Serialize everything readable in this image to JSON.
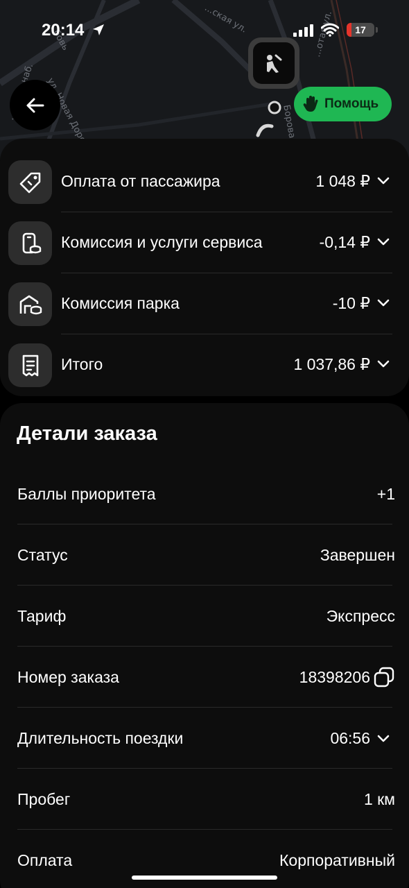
{
  "status_bar": {
    "time": "20:14",
    "battery_level": "17",
    "battery_fraction": 0.17
  },
  "map": {
    "streets": [
      "ул. Новая Дорога",
      "Боровая ул.",
      "...льная наб.",
      "...ская ул.",
      "...отая ул.",
      "...бовь"
    ]
  },
  "help_button": {
    "label": "Помощь"
  },
  "breakdown": {
    "rows": [
      {
        "label": "Оплата от пассажира",
        "value": "1 048 ₽",
        "icon": "tag-icon"
      },
      {
        "label": "Комиссия и услуги сервиса",
        "value": "-0,14 ₽",
        "icon": "phone-coin-icon"
      },
      {
        "label": "Комиссия парка",
        "value": "-10 ₽",
        "icon": "garage-coin-icon"
      },
      {
        "label": "Итого",
        "value": "1 037,86 ₽",
        "icon": "receipt-icon"
      }
    ]
  },
  "details": {
    "title": "Детали заказа",
    "rows": [
      {
        "label": "Баллы приоритета",
        "value": "+1"
      },
      {
        "label": "Статус",
        "value": "Завершен"
      },
      {
        "label": "Тариф",
        "value": "Экспресс"
      },
      {
        "label": "Номер заказа",
        "value": "18398206"
      },
      {
        "label": "Длительность поездки",
        "value": "06:56"
      },
      {
        "label": "Пробег",
        "value": "1 км"
      },
      {
        "label": "Оплата",
        "value": "Корпоративный"
      }
    ]
  },
  "colors": {
    "accent_green": "#1fb753",
    "battery_red": "#e5342b",
    "card_bg": "#0d0d0d"
  }
}
